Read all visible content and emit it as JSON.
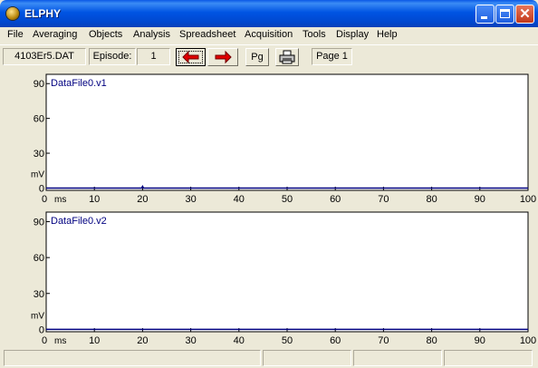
{
  "window": {
    "title": "ELPHY",
    "icon": "elphy-app-icon",
    "close_glyph": "✕"
  },
  "menu": [
    "File",
    "Averaging",
    "Objects",
    "Analysis",
    "Spreadsheet",
    "Acquisition",
    "Tools",
    "Display",
    "Help"
  ],
  "toolbar": {
    "file_name": "4103Er5.DAT",
    "episode_label": "Episode:",
    "episode_value": "1",
    "prev_icon": "red-left-arrow-icon",
    "next_icon": "red-right-arrow-icon",
    "page_button": "Pg",
    "print_icon": "printer-icon",
    "page_label": "Page 1"
  },
  "chart_data": [
    {
      "type": "line",
      "series": [
        {
          "name": "DataFile0.v1",
          "x": [
            0,
            19.8,
            20,
            20.2,
            100
          ],
          "values": [
            0,
            0,
            1.5,
            0,
            0
          ]
        }
      ],
      "xlim": [
        0,
        100
      ],
      "ylim": [
        -2,
        98
      ],
      "xticks": [
        "0",
        "10",
        "20",
        "30",
        "40",
        "50",
        "60",
        "70",
        "80",
        "90",
        "100"
      ],
      "yticks": [
        "90",
        "60",
        "30",
        "0"
      ],
      "xlabel": "ms",
      "ylabel": "mV",
      "line_color": "#000080"
    },
    {
      "type": "line",
      "series": [
        {
          "name": "DataFile0.v2",
          "x": [
            0,
            100
          ],
          "values": [
            0,
            0
          ]
        }
      ],
      "xlim": [
        0,
        100
      ],
      "ylim": [
        -2,
        98
      ],
      "xticks": [
        "0",
        "10",
        "20",
        "30",
        "40",
        "50",
        "60",
        "70",
        "80",
        "90",
        "100"
      ],
      "yticks": [
        "90",
        "60",
        "30",
        "0"
      ],
      "xlabel": "ms",
      "ylabel": "mV",
      "line_color": "#000080"
    }
  ],
  "status_panels": [
    "",
    "",
    "",
    "",
    ""
  ]
}
